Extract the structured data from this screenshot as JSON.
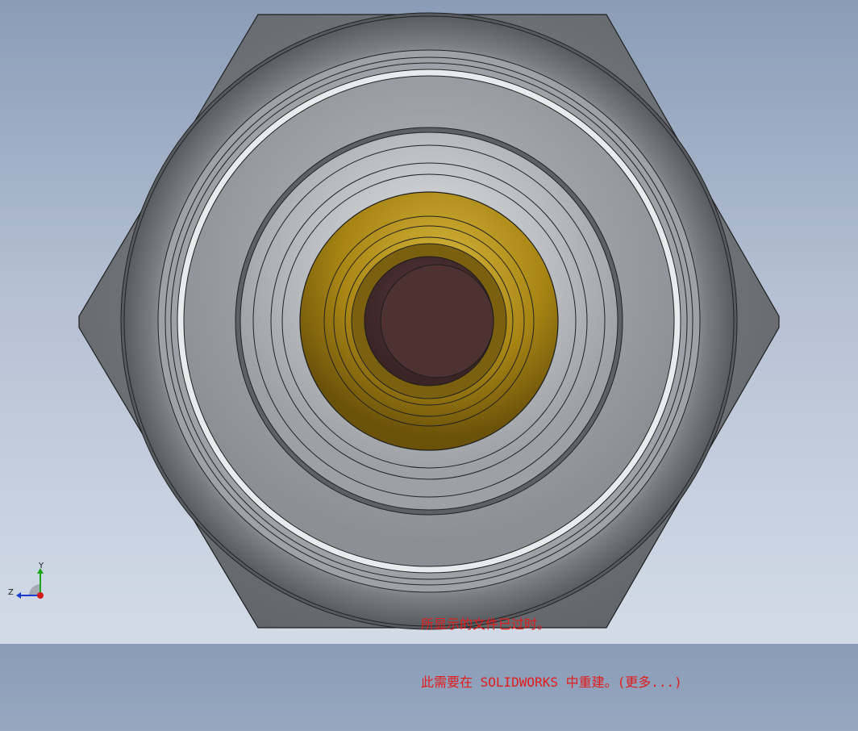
{
  "app": {
    "name": "SOLIDWORKS"
  },
  "viewport": {
    "background_top": "#8a9cb7",
    "background_bottom": "#d3dbe7",
    "model": {
      "view": "front",
      "hex_body_color": "#7b7f83",
      "ring_colors": [
        "#8b9094",
        "#a8acb0",
        "#c8ccd0",
        "#9ea2a6",
        "#d2d5d8"
      ],
      "brass_insert_color": "#b08d1c",
      "bore_color": "#5a3838"
    }
  },
  "triad": {
    "y_label": "Y",
    "z_label": "Z",
    "y_color": "#1aa51a",
    "x_color": "#1a3ccf",
    "origin_color": "#d21c1c"
  },
  "warning": {
    "line1": "所显示的文件已过时。",
    "line2_prefix": "此需要在 SOLIDWORKS 中重建。",
    "line2_more": "(更多...)",
    "color": "#e21b1b"
  }
}
